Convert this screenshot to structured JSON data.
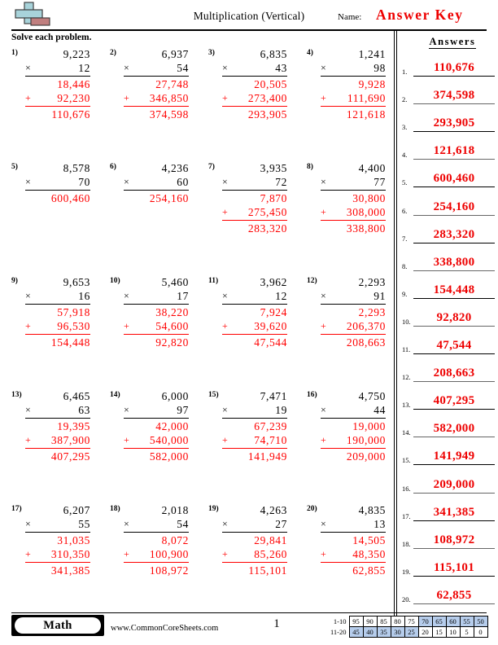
{
  "header": {
    "title": "Multiplication (Vertical)",
    "name_label": "Name:",
    "answer_key": "Answer Key",
    "instruction": "Solve each problem.",
    "logo_name": "plus-block-logo"
  },
  "answers_panel": {
    "title": "Answers",
    "items": [
      {
        "num": "1.",
        "value": "110,676"
      },
      {
        "num": "2.",
        "value": "374,598"
      },
      {
        "num": "3.",
        "value": "293,905"
      },
      {
        "num": "4.",
        "value": "121,618"
      },
      {
        "num": "5.",
        "value": "600,460"
      },
      {
        "num": "6.",
        "value": "254,160"
      },
      {
        "num": "7.",
        "value": "283,320"
      },
      {
        "num": "8.",
        "value": "338,800"
      },
      {
        "num": "9.",
        "value": "154,448"
      },
      {
        "num": "10.",
        "value": "92,820"
      },
      {
        "num": "11.",
        "value": "47,544"
      },
      {
        "num": "12.",
        "value": "208,663"
      },
      {
        "num": "13.",
        "value": "407,295"
      },
      {
        "num": "14.",
        "value": "582,000"
      },
      {
        "num": "15.",
        "value": "141,949"
      },
      {
        "num": "16.",
        "value": "209,000"
      },
      {
        "num": "17.",
        "value": "341,385"
      },
      {
        "num": "18.",
        "value": "108,972"
      },
      {
        "num": "19.",
        "value": "115,101"
      },
      {
        "num": "20.",
        "value": "62,855"
      }
    ]
  },
  "problems": [
    {
      "num": "1)",
      "multiplicand": "9,223",
      "sign": "×",
      "multiplier": "12",
      "partials": [
        "18,446",
        "92,230"
      ],
      "plus": "+",
      "product": "110,676"
    },
    {
      "num": "2)",
      "multiplicand": "6,937",
      "sign": "×",
      "multiplier": "54",
      "partials": [
        "27,748",
        "346,850"
      ],
      "plus": "+",
      "product": "374,598"
    },
    {
      "num": "3)",
      "multiplicand": "6,835",
      "sign": "×",
      "multiplier": "43",
      "partials": [
        "20,505",
        "273,400"
      ],
      "plus": "+",
      "product": "293,905"
    },
    {
      "num": "4)",
      "multiplicand": "1,241",
      "sign": "×",
      "multiplier": "98",
      "partials": [
        "9,928",
        "111,690"
      ],
      "plus": "+",
      "product": "121,618"
    },
    {
      "num": "5)",
      "multiplicand": "8,578",
      "sign": "×",
      "multiplier": "70",
      "partials": [],
      "plus": "+",
      "product": "600,460"
    },
    {
      "num": "6)",
      "multiplicand": "4,236",
      "sign": "×",
      "multiplier": "60",
      "partials": [],
      "plus": "+",
      "product": "254,160"
    },
    {
      "num": "7)",
      "multiplicand": "3,935",
      "sign": "×",
      "multiplier": "72",
      "partials": [
        "7,870",
        "275,450"
      ],
      "plus": "+",
      "product": "283,320"
    },
    {
      "num": "8)",
      "multiplicand": "4,400",
      "sign": "×",
      "multiplier": "77",
      "partials": [
        "30,800",
        "308,000"
      ],
      "plus": "+",
      "product": "338,800"
    },
    {
      "num": "9)",
      "multiplicand": "9,653",
      "sign": "×",
      "multiplier": "16",
      "partials": [
        "57,918",
        "96,530"
      ],
      "plus": "+",
      "product": "154,448"
    },
    {
      "num": "10)",
      "multiplicand": "5,460",
      "sign": "×",
      "multiplier": "17",
      "partials": [
        "38,220",
        "54,600"
      ],
      "plus": "+",
      "product": "92,820"
    },
    {
      "num": "11)",
      "multiplicand": "3,962",
      "sign": "×",
      "multiplier": "12",
      "partials": [
        "7,924",
        "39,620"
      ],
      "plus": "+",
      "product": "47,544"
    },
    {
      "num": "12)",
      "multiplicand": "2,293",
      "sign": "×",
      "multiplier": "91",
      "partials": [
        "2,293",
        "206,370"
      ],
      "plus": "+",
      "product": "208,663"
    },
    {
      "num": "13)",
      "multiplicand": "6,465",
      "sign": "×",
      "multiplier": "63",
      "partials": [
        "19,395",
        "387,900"
      ],
      "plus": "+",
      "product": "407,295"
    },
    {
      "num": "14)",
      "multiplicand": "6,000",
      "sign": "×",
      "multiplier": "97",
      "partials": [
        "42,000",
        "540,000"
      ],
      "plus": "+",
      "product": "582,000"
    },
    {
      "num": "15)",
      "multiplicand": "7,471",
      "sign": "×",
      "multiplier": "19",
      "partials": [
        "67,239",
        "74,710"
      ],
      "plus": "+",
      "product": "141,949"
    },
    {
      "num": "16)",
      "multiplicand": "4,750",
      "sign": "×",
      "multiplier": "44",
      "partials": [
        "19,000",
        "190,000"
      ],
      "plus": "+",
      "product": "209,000"
    },
    {
      "num": "17)",
      "multiplicand": "6,207",
      "sign": "×",
      "multiplier": "55",
      "partials": [
        "31,035",
        "310,350"
      ],
      "plus": "+",
      "product": "341,385"
    },
    {
      "num": "18)",
      "multiplicand": "2,018",
      "sign": "×",
      "multiplier": "54",
      "partials": [
        "8,072",
        "100,900"
      ],
      "plus": "+",
      "product": "108,972"
    },
    {
      "num": "19)",
      "multiplicand": "4,263",
      "sign": "×",
      "multiplier": "27",
      "partials": [
        "29,841",
        "85,260"
      ],
      "plus": "+",
      "product": "115,101"
    },
    {
      "num": "20)",
      "multiplicand": "4,835",
      "sign": "×",
      "multiplier": "13",
      "partials": [
        "14,505",
        "48,350"
      ],
      "plus": "+",
      "product": "62,855"
    }
  ],
  "footer": {
    "subject_badge": "Math",
    "site_url": "www.CommonCoreSheets.com",
    "page_number": "1",
    "grading_scale": {
      "row1_label": "1-10",
      "row2_label": "11-20",
      "row1": [
        {
          "value": "95",
          "shaded": false
        },
        {
          "value": "90",
          "shaded": false
        },
        {
          "value": "85",
          "shaded": false
        },
        {
          "value": "80",
          "shaded": false
        },
        {
          "value": "75",
          "shaded": false
        },
        {
          "value": "70",
          "shaded": true
        },
        {
          "value": "65",
          "shaded": true
        },
        {
          "value": "60",
          "shaded": true
        },
        {
          "value": "55",
          "shaded": true
        },
        {
          "value": "50",
          "shaded": true
        }
      ],
      "row2": [
        {
          "value": "45",
          "shaded": true
        },
        {
          "value": "40",
          "shaded": true
        },
        {
          "value": "35",
          "shaded": true
        },
        {
          "value": "30",
          "shaded": true
        },
        {
          "value": "25",
          "shaded": true
        },
        {
          "value": "20",
          "shaded": false
        },
        {
          "value": "15",
          "shaded": false
        },
        {
          "value": "10",
          "shaded": false
        },
        {
          "value": "5",
          "shaded": false
        },
        {
          "value": "0",
          "shaded": false
        }
      ]
    }
  },
  "colors": {
    "answer_red": "#ee0000",
    "work_red": "#ff0000",
    "shade_blue": "#b6cdec",
    "logo_teal": "#a8d3da",
    "logo_brick": "#c07f7f"
  }
}
